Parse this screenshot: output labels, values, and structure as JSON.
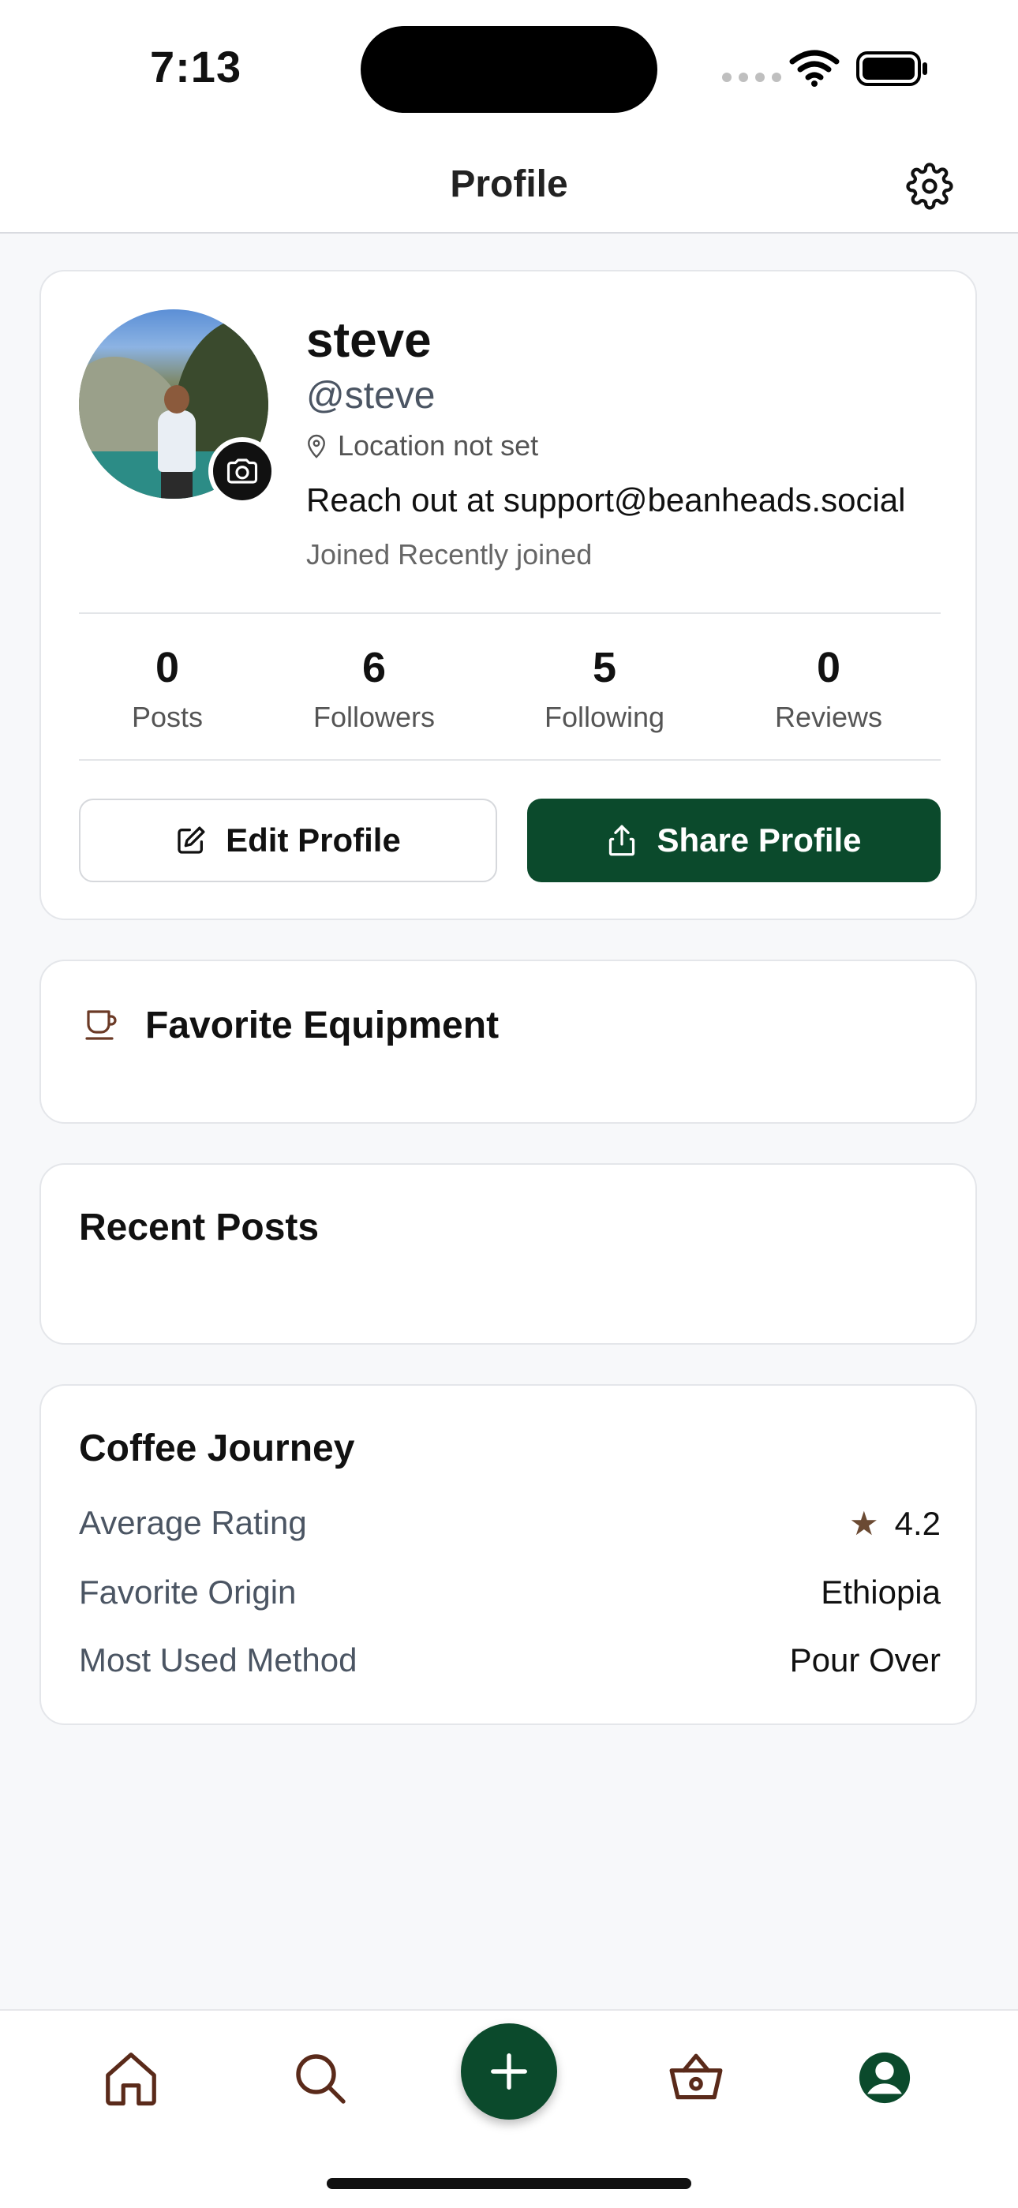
{
  "status_bar": {
    "time": "7:13"
  },
  "header": {
    "title": "Profile"
  },
  "profile": {
    "name": "steve",
    "handle": "@steve",
    "location": "Location not set",
    "bio": "Reach out at support@beanheads.social",
    "joined": "Joined Recently joined"
  },
  "stats": [
    {
      "value": "0",
      "label": "Posts"
    },
    {
      "value": "6",
      "label": "Followers"
    },
    {
      "value": "5",
      "label": "Following"
    },
    {
      "value": "0",
      "label": "Reviews"
    }
  ],
  "actions": {
    "edit_label": "Edit Profile",
    "share_label": "Share Profile"
  },
  "favorite_equipment": {
    "title": "Favorite Equipment"
  },
  "recent_posts": {
    "title": "Recent Posts"
  },
  "coffee_journey": {
    "title": "Coffee Journey",
    "rows": [
      {
        "label": "Average Rating",
        "value": "4.2"
      },
      {
        "label": "Favorite Origin",
        "value": "Ethiopia"
      },
      {
        "label": "Most Used Method",
        "value": "Pour Over"
      }
    ]
  },
  "colors": {
    "brand_green": "#0b4a2c",
    "icon_brown": "#5a2a1a",
    "star": "#6b4a33"
  },
  "icons": [
    "gear-icon",
    "camera-icon",
    "location-pin-icon",
    "edit-icon",
    "share-icon",
    "cup-icon",
    "star-icon",
    "home-icon",
    "search-icon",
    "plus-icon",
    "basket-icon",
    "profile-icon"
  ]
}
